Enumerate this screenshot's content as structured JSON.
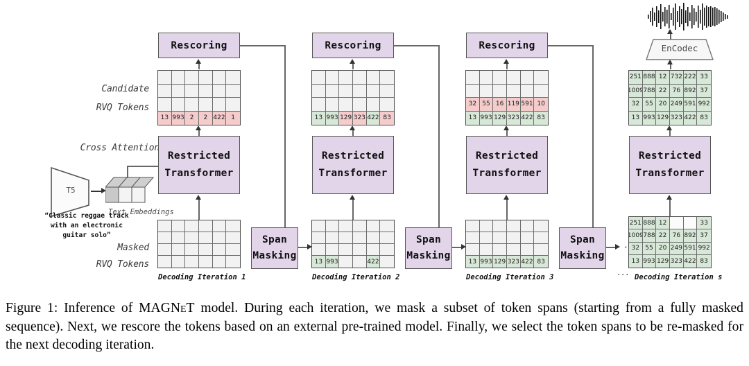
{
  "figure": {
    "caption": "Figure 1: Inference of MAGNeT model. During each iteration, we mask a subset of token spans (starting from a fully masked sequence). Next, we rescore the tokens based on an external pre-trained model. Finally, we select the token spans to be re-masked for the next decoding iteration.",
    "caption_prefix": "Figure 1: Inference of ",
    "caption_model": "MAGNeT",
    "caption_rest": " model. During each iteration, we mask a subset of token spans (starting from a fully masked sequence). Next, we rescore the tokens based on an external pre-trained model. Finally, we select the token spans to be re-masked for the next decoding iteration."
  },
  "labels": {
    "candidate_line1": "Candidate",
    "candidate_line2": "RVQ Tokens",
    "masked_line1": "Masked",
    "masked_line2": "RVQ Tokens",
    "cross_attention": "Cross Attention",
    "text_embeddings": "Text Embeddings",
    "t5": "T5",
    "encodec": "EnCodec",
    "prompt_line1": "“Classic reggae track",
    "prompt_line2": "with an electronic",
    "prompt_line3": "guitar solo”",
    "ellipsis": "···",
    "ellipsis_iter": "···"
  },
  "blocks": {
    "rescoring": "Rescoring",
    "transformer_line1": "Restricted",
    "transformer_line2": "Transformer",
    "span_line1": "Span",
    "span_line2": "Masking"
  },
  "iterations": [
    {
      "id": "iter1",
      "label": "Decoding Iteration 1",
      "candidate_grid": {
        "rows": 4,
        "cols": 6,
        "cells": [
          [
            {
              "v": "",
              "s": "empty"
            },
            {
              "v": "",
              "s": "empty"
            },
            {
              "v": "",
              "s": "empty"
            },
            {
              "v": "",
              "s": "empty"
            },
            {
              "v": "",
              "s": "empty"
            },
            {
              "v": "",
              "s": "empty"
            }
          ],
          [
            {
              "v": "",
              "s": "empty"
            },
            {
              "v": "",
              "s": "empty"
            },
            {
              "v": "",
              "s": "empty"
            },
            {
              "v": "",
              "s": "empty"
            },
            {
              "v": "",
              "s": "empty"
            },
            {
              "v": "",
              "s": "empty"
            }
          ],
          [
            {
              "v": "",
              "s": "empty"
            },
            {
              "v": "",
              "s": "empty"
            },
            {
              "v": "",
              "s": "empty"
            },
            {
              "v": "",
              "s": "empty"
            },
            {
              "v": "",
              "s": "empty"
            },
            {
              "v": "",
              "s": "empty"
            }
          ],
          [
            {
              "v": "13",
              "s": "pink"
            },
            {
              "v": "993",
              "s": "pink"
            },
            {
              "v": "2",
              "s": "pink"
            },
            {
              "v": "2",
              "s": "pink"
            },
            {
              "v": "422",
              "s": "pink"
            },
            {
              "v": "1",
              "s": "pink"
            }
          ]
        ]
      },
      "masked_grid": {
        "rows": 4,
        "cols": 6,
        "cells": [
          [
            {
              "v": "",
              "s": "empty"
            },
            {
              "v": "",
              "s": "empty"
            },
            {
              "v": "",
              "s": "empty"
            },
            {
              "v": "",
              "s": "empty"
            },
            {
              "v": "",
              "s": "empty"
            },
            {
              "v": "",
              "s": "empty"
            }
          ],
          [
            {
              "v": "",
              "s": "empty"
            },
            {
              "v": "",
              "s": "empty"
            },
            {
              "v": "",
              "s": "empty"
            },
            {
              "v": "",
              "s": "empty"
            },
            {
              "v": "",
              "s": "empty"
            },
            {
              "v": "",
              "s": "empty"
            }
          ],
          [
            {
              "v": "",
              "s": "empty"
            },
            {
              "v": "",
              "s": "empty"
            },
            {
              "v": "",
              "s": "empty"
            },
            {
              "v": "",
              "s": "empty"
            },
            {
              "v": "",
              "s": "empty"
            },
            {
              "v": "",
              "s": "empty"
            }
          ],
          [
            {
              "v": "",
              "s": "empty"
            },
            {
              "v": "",
              "s": "empty"
            },
            {
              "v": "",
              "s": "empty"
            },
            {
              "v": "",
              "s": "empty"
            },
            {
              "v": "",
              "s": "empty"
            },
            {
              "v": "",
              "s": "empty"
            }
          ]
        ]
      }
    },
    {
      "id": "iter2",
      "label": "Decoding Iteration 2",
      "candidate_grid": {
        "rows": 4,
        "cols": 6,
        "cells": [
          [
            {
              "v": "",
              "s": "empty"
            },
            {
              "v": "",
              "s": "empty"
            },
            {
              "v": "",
              "s": "empty"
            },
            {
              "v": "",
              "s": "empty"
            },
            {
              "v": "",
              "s": "empty"
            },
            {
              "v": "",
              "s": "empty"
            }
          ],
          [
            {
              "v": "",
              "s": "empty"
            },
            {
              "v": "",
              "s": "empty"
            },
            {
              "v": "",
              "s": "empty"
            },
            {
              "v": "",
              "s": "empty"
            },
            {
              "v": "",
              "s": "empty"
            },
            {
              "v": "",
              "s": "empty"
            }
          ],
          [
            {
              "v": "",
              "s": "empty"
            },
            {
              "v": "",
              "s": "empty"
            },
            {
              "v": "",
              "s": "empty"
            },
            {
              "v": "",
              "s": "empty"
            },
            {
              "v": "",
              "s": "empty"
            },
            {
              "v": "",
              "s": "empty"
            }
          ],
          [
            {
              "v": "13",
              "s": "green"
            },
            {
              "v": "993",
              "s": "green"
            },
            {
              "v": "129",
              "s": "pink"
            },
            {
              "v": "323",
              "s": "pink"
            },
            {
              "v": "422",
              "s": "green"
            },
            {
              "v": "83",
              "s": "pink"
            }
          ]
        ]
      },
      "masked_grid": {
        "rows": 4,
        "cols": 6,
        "cells": [
          [
            {
              "v": "",
              "s": "empty"
            },
            {
              "v": "",
              "s": "empty"
            },
            {
              "v": "",
              "s": "empty"
            },
            {
              "v": "",
              "s": "empty"
            },
            {
              "v": "",
              "s": "empty"
            },
            {
              "v": "",
              "s": "empty"
            }
          ],
          [
            {
              "v": "",
              "s": "empty"
            },
            {
              "v": "",
              "s": "empty"
            },
            {
              "v": "",
              "s": "empty"
            },
            {
              "v": "",
              "s": "empty"
            },
            {
              "v": "",
              "s": "empty"
            },
            {
              "v": "",
              "s": "empty"
            }
          ],
          [
            {
              "v": "",
              "s": "empty"
            },
            {
              "v": "",
              "s": "empty"
            },
            {
              "v": "",
              "s": "empty"
            },
            {
              "v": "",
              "s": "empty"
            },
            {
              "v": "",
              "s": "empty"
            },
            {
              "v": "",
              "s": "empty"
            }
          ],
          [
            {
              "v": "13",
              "s": "green"
            },
            {
              "v": "993",
              "s": "green"
            },
            {
              "v": "",
              "s": "empty"
            },
            {
              "v": "",
              "s": "empty"
            },
            {
              "v": "422",
              "s": "green"
            },
            {
              "v": "",
              "s": "empty"
            }
          ]
        ]
      }
    },
    {
      "id": "iter3",
      "label": "Decoding Iteration 3",
      "candidate_grid": {
        "rows": 4,
        "cols": 6,
        "cells": [
          [
            {
              "v": "",
              "s": "empty"
            },
            {
              "v": "",
              "s": "empty"
            },
            {
              "v": "",
              "s": "empty"
            },
            {
              "v": "",
              "s": "empty"
            },
            {
              "v": "",
              "s": "empty"
            },
            {
              "v": "",
              "s": "empty"
            }
          ],
          [
            {
              "v": "",
              "s": "empty"
            },
            {
              "v": "",
              "s": "empty"
            },
            {
              "v": "",
              "s": "empty"
            },
            {
              "v": "",
              "s": "empty"
            },
            {
              "v": "",
              "s": "empty"
            },
            {
              "v": "",
              "s": "empty"
            }
          ],
          [
            {
              "v": "32",
              "s": "pink"
            },
            {
              "v": "55",
              "s": "pink"
            },
            {
              "v": "16",
              "s": "pink"
            },
            {
              "v": "119",
              "s": "pink"
            },
            {
              "v": "591",
              "s": "pink"
            },
            {
              "v": "10",
              "s": "pink"
            }
          ],
          [
            {
              "v": "13",
              "s": "green"
            },
            {
              "v": "993",
              "s": "green"
            },
            {
              "v": "129",
              "s": "green"
            },
            {
              "v": "323",
              "s": "green"
            },
            {
              "v": "422",
              "s": "green"
            },
            {
              "v": "83",
              "s": "green"
            }
          ]
        ]
      },
      "masked_grid": {
        "rows": 4,
        "cols": 6,
        "cells": [
          [
            {
              "v": "",
              "s": "empty"
            },
            {
              "v": "",
              "s": "empty"
            },
            {
              "v": "",
              "s": "empty"
            },
            {
              "v": "",
              "s": "empty"
            },
            {
              "v": "",
              "s": "empty"
            },
            {
              "v": "",
              "s": "empty"
            }
          ],
          [
            {
              "v": "",
              "s": "empty"
            },
            {
              "v": "",
              "s": "empty"
            },
            {
              "v": "",
              "s": "empty"
            },
            {
              "v": "",
              "s": "empty"
            },
            {
              "v": "",
              "s": "empty"
            },
            {
              "v": "",
              "s": "empty"
            }
          ],
          [
            {
              "v": "",
              "s": "empty"
            },
            {
              "v": "",
              "s": "empty"
            },
            {
              "v": "",
              "s": "empty"
            },
            {
              "v": "",
              "s": "empty"
            },
            {
              "v": "",
              "s": "empty"
            },
            {
              "v": "",
              "s": "empty"
            }
          ],
          [
            {
              "v": "13",
              "s": "green"
            },
            {
              "v": "993",
              "s": "green"
            },
            {
              "v": "129",
              "s": "green"
            },
            {
              "v": "323",
              "s": "green"
            },
            {
              "v": "422",
              "s": "green"
            },
            {
              "v": "83",
              "s": "green"
            }
          ]
        ]
      }
    },
    {
      "id": "iterS",
      "label": "Decoding Iteration s",
      "candidate_grid": {
        "rows": 4,
        "cols": 6,
        "cells": [
          [
            {
              "v": "251",
              "s": "green"
            },
            {
              "v": "888",
              "s": "green"
            },
            {
              "v": "12",
              "s": "green"
            },
            {
              "v": "732",
              "s": "green"
            },
            {
              "v": "222",
              "s": "green"
            },
            {
              "v": "33",
              "s": "green"
            }
          ],
          [
            {
              "v": "1009",
              "s": "green"
            },
            {
              "v": "788",
              "s": "green"
            },
            {
              "v": "22",
              "s": "green"
            },
            {
              "v": "76",
              "s": "green"
            },
            {
              "v": "892",
              "s": "green"
            },
            {
              "v": "37",
              "s": "green"
            }
          ],
          [
            {
              "v": "32",
              "s": "green"
            },
            {
              "v": "55",
              "s": "green"
            },
            {
              "v": "20",
              "s": "green"
            },
            {
              "v": "249",
              "s": "green"
            },
            {
              "v": "591",
              "s": "green"
            },
            {
              "v": "992",
              "s": "green"
            }
          ],
          [
            {
              "v": "13",
              "s": "green"
            },
            {
              "v": "993",
              "s": "green"
            },
            {
              "v": "129",
              "s": "green"
            },
            {
              "v": "323",
              "s": "green"
            },
            {
              "v": "422",
              "s": "green"
            },
            {
              "v": "83",
              "s": "green"
            }
          ]
        ]
      },
      "masked_grid": {
        "rows": 4,
        "cols": 6,
        "cells": [
          [
            {
              "v": "251",
              "s": "green"
            },
            {
              "v": "888",
              "s": "green"
            },
            {
              "v": "12",
              "s": "green"
            },
            {
              "v": "",
              "s": "white"
            },
            {
              "v": "",
              "s": "white"
            },
            {
              "v": "33",
              "s": "green"
            }
          ],
          [
            {
              "v": "1009",
              "s": "green"
            },
            {
              "v": "788",
              "s": "green"
            },
            {
              "v": "22",
              "s": "green"
            },
            {
              "v": "76",
              "s": "green"
            },
            {
              "v": "892",
              "s": "green"
            },
            {
              "v": "37",
              "s": "green"
            }
          ],
          [
            {
              "v": "32",
              "s": "green"
            },
            {
              "v": "55",
              "s": "green"
            },
            {
              "v": "20",
              "s": "green"
            },
            {
              "v": "249",
              "s": "green"
            },
            {
              "v": "591",
              "s": "green"
            },
            {
              "v": "992",
              "s": "green"
            }
          ],
          [
            {
              "v": "13",
              "s": "green"
            },
            {
              "v": "993",
              "s": "green"
            },
            {
              "v": "129",
              "s": "green"
            },
            {
              "v": "323",
              "s": "green"
            },
            {
              "v": "422",
              "s": "green"
            },
            {
              "v": "83",
              "s": "green"
            }
          ]
        ]
      }
    }
  ],
  "colors": {
    "lavender": "#e2d5ea",
    "green": "#d8e8d8",
    "pink": "#f5cccc",
    "grid_empty": "#f2f2f2",
    "line": "#666666"
  }
}
